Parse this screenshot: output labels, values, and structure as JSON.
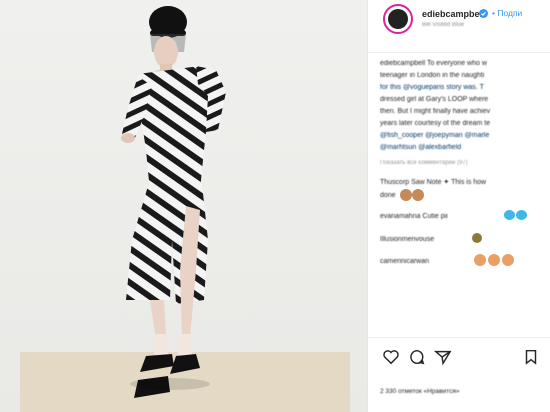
{
  "post": {
    "username": "ediebcampbell",
    "follow_label": "• Подпи",
    "location": "Bel Visited Blue",
    "caption_lines": [
      "ediebcampbell To everyone who w",
      "teenager in London in the naughti",
      "for this @vogueparis story was. T",
      "dressed girl at Gary's LOOP where",
      "then. But I might finally have achiev",
      "years later courtesy of the dream te",
      "@fish_cooper @joepyman @marle",
      "@marhtsun @alexbarfield"
    ],
    "translate_label": "Показать все комментарии (97)",
    "comments": [
      {
        "text": "Thuscorp Saw Note ✦ This is how",
        "extra": "done"
      },
      {
        "text": "evanamahna Cutie pii"
      },
      {
        "text": "Illusionmenvouse"
      },
      {
        "text": "camerinicarwan"
      }
    ],
    "likes_text": "2 330 отметок «Нравится»"
  },
  "colors": {
    "accent": "#3897f0",
    "avatar_ring": "#d6249f",
    "emoji_brown": "#c68a5a",
    "emoji_blue": "#3fb7e8",
    "emoji_orange": "#e8a064"
  },
  "icons": [
    "verified-icon",
    "heart-icon",
    "comment-icon",
    "share-icon",
    "bookmark-icon"
  ]
}
